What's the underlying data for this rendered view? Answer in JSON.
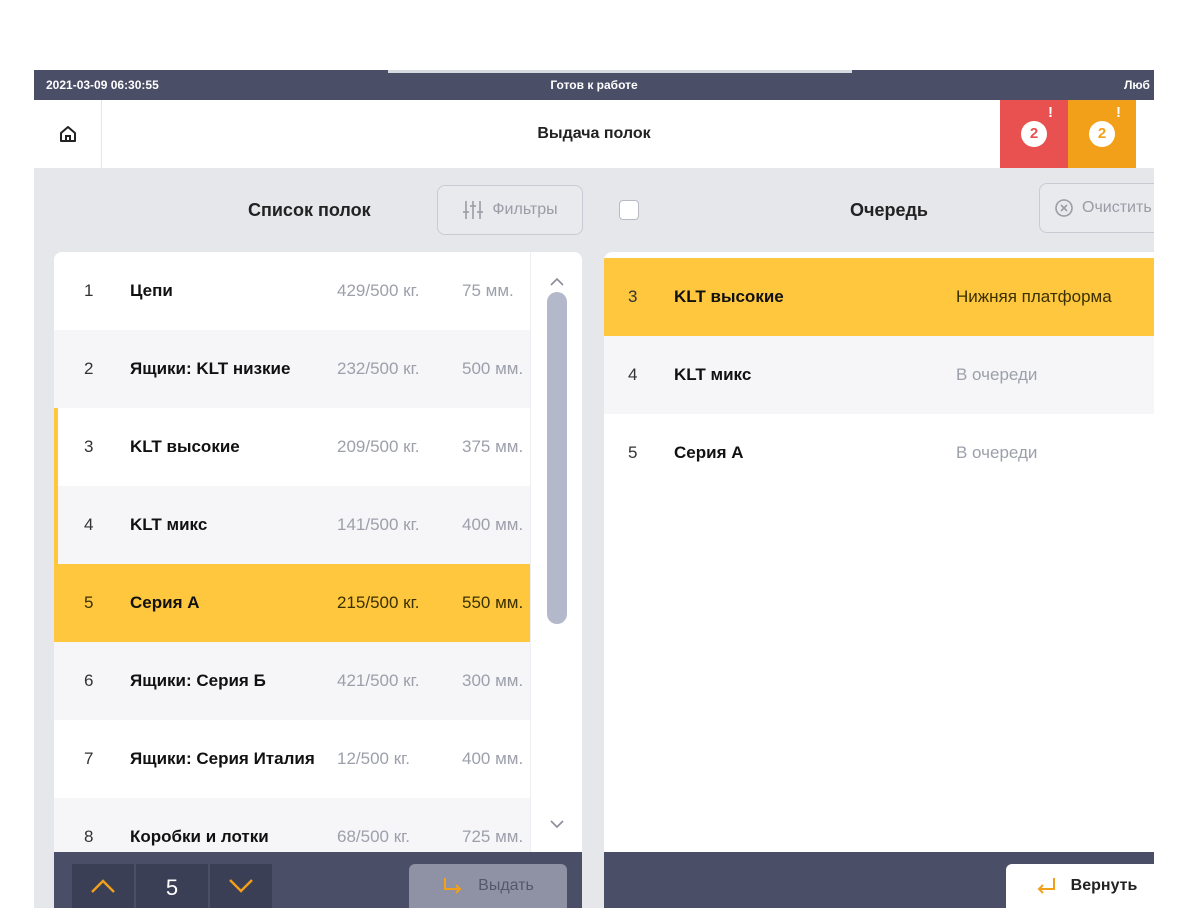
{
  "statusbar": {
    "datetime": "2021-03-09 06:30:55",
    "status": "Готов к работе",
    "user": "Люб"
  },
  "header": {
    "title": "Выдача полок",
    "alerts": [
      {
        "count": "2",
        "mark": "!",
        "color": "#e8514f"
      },
      {
        "count": "2",
        "mark": "!",
        "color": "#f2a019"
      }
    ]
  },
  "shelf_list": {
    "title": "Список полок",
    "filter_label": "Фильтры",
    "rows": [
      {
        "num": "1",
        "name": "Цепи",
        "weight": "429/500 кг.",
        "height": "75 мм."
      },
      {
        "num": "2",
        "name": "Ящики: KLT низкие",
        "weight": "232/500 кг.",
        "height": "500 мм."
      },
      {
        "num": "3",
        "name": "KLT высокие",
        "weight": "209/500 кг.",
        "height": "375 мм."
      },
      {
        "num": "4",
        "name": "KLT микс",
        "weight": "141/500 кг.",
        "height": "400 мм."
      },
      {
        "num": "5",
        "name": "Серия А",
        "weight": "215/500 кг.",
        "height": "550 мм."
      },
      {
        "num": "6",
        "name": "Ящики: Серия Б",
        "weight": "421/500 кг.",
        "height": "300 мм."
      },
      {
        "num": "7",
        "name": "Ящики: Серия Италия",
        "weight": "12/500 кг.",
        "height": "400 мм."
      },
      {
        "num": "8",
        "name": "Коробки и лотки",
        "weight": "68/500 кг.",
        "height": "725 мм."
      }
    ],
    "stepper_value": "5",
    "issue_label": "Выдать"
  },
  "queue": {
    "title": "Очередь",
    "clear_label": "Очистить",
    "rows": [
      {
        "num": "3",
        "name": "KLT высокие",
        "status": "Нижняя платформа"
      },
      {
        "num": "4",
        "name": "KLT микс",
        "status": "В очереди"
      },
      {
        "num": "5",
        "name": "Серия А",
        "status": "В очереди"
      }
    ],
    "return_label": "Вернуть"
  },
  "colors": {
    "accent_yellow": "#fec73d",
    "dark_bar": "#4a4e66",
    "alert_red": "#e8514f",
    "alert_orange": "#f2a019"
  }
}
